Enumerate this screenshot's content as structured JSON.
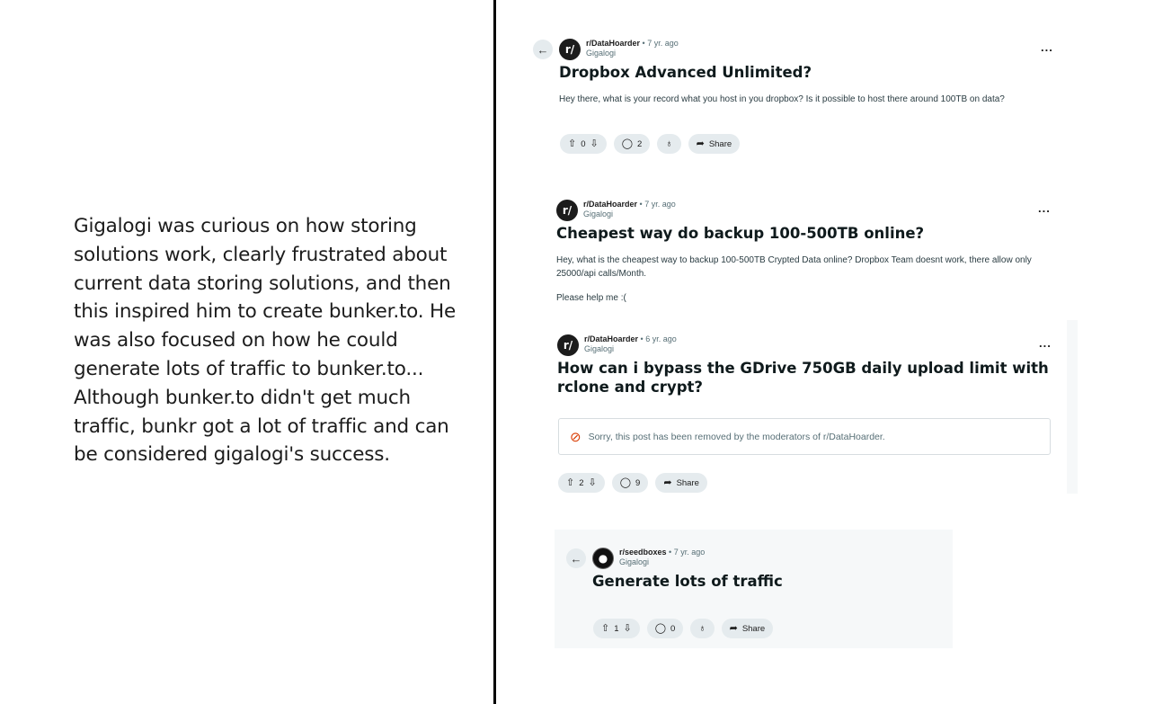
{
  "narrative": "Gigalogi was curious on how storing solutions work, clearly frustrated about current data storing solutions, and then this inspired him to create bunker.to. He was also focused on how he could generate lots of traffic to bunker.to... Although bunker.to didn't get much traffic, bunkr got a lot of traffic and can be considered gigalogi's success.",
  "posts": [
    {
      "subreddit": "r/DataHoarder",
      "age": "7 yr. ago",
      "user": "Gigalogi",
      "title": "Dropbox Advanced Unlimited?",
      "body": "Hey there, what is your record what you host in you dropbox? Is it possible to host there around 100TB on data?",
      "votes": "0",
      "comments": "2",
      "share": "Share",
      "more": "..."
    },
    {
      "subreddit": "r/DataHoarder",
      "age": "7 yr. ago",
      "user": "Gigalogi",
      "title": "Cheapest way do backup 100-500TB online?",
      "body": "Hey, what is the cheapest way to backup 100-500TB Crypted Data online? Dropbox Team doesnt work, there allow only 25000/api calls/Month.",
      "body2": "Please help me :(",
      "more": "..."
    },
    {
      "subreddit": "r/DataHoarder",
      "age": "6 yr. ago",
      "user": "Gigalogi",
      "title": "How can i bypass the GDrive 750GB daily upload limit with rclone and crypt?",
      "removed": "Sorry, this post has been removed by the moderators of r/DataHoarder.",
      "votes": "2",
      "comments": "9",
      "share": "Share",
      "more": "..."
    },
    {
      "subreddit": "r/seedboxes",
      "age": "7 yr. ago",
      "user": "Gigalogi",
      "title": "Generate lots of traffic",
      "votes": "1",
      "comments": "0",
      "share": "Share"
    }
  ],
  "icons": {
    "back": "arrow-left-icon",
    "upvote": "arrow-up-icon",
    "downvote": "arrow-down-icon",
    "comment": "comment-bubble-icon",
    "award": "award-icon",
    "share": "share-arrow-icon",
    "ban": "ban-icon"
  },
  "dot": "•",
  "colors": {
    "pill_bg": "#e5ebee",
    "muted": "#576f76",
    "removed_icon": "#d93a00"
  }
}
